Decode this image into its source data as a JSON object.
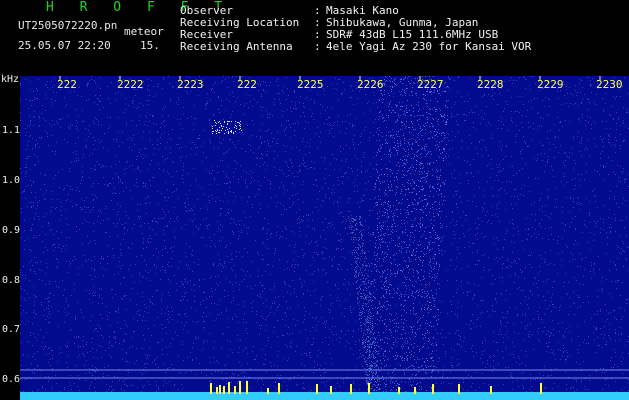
{
  "header": {
    "title": "H R O F F T",
    "file_name": "UT2505072220.pn",
    "file_suffix": "meteor",
    "date_time": "25.05.07 22:20",
    "count": "15.",
    "info": [
      {
        "label": "Observer",
        "value": "Masaki Kano"
      },
      {
        "label": "Receiving Location",
        "value": "Shibukawa, Gunma, Japan"
      },
      {
        "label": "Receiver",
        "value": "SDR# 43dB L15 111.6MHz USB"
      },
      {
        "label": "Receiving Antenna",
        "value": "4ele Yagi Az 230 for Kansai VOR"
      }
    ],
    "colon": ":"
  },
  "spectrogram": {
    "unit": "kHz",
    "x_tick_labels": [
      "222",
      "2222",
      "2223",
      "222",
      "2225",
      "2226",
      "2227",
      "2228",
      "2229",
      "2230"
    ],
    "y_tick_labels": [
      "1.1",
      "1.0",
      "0.9",
      "0.8",
      "0.7",
      "0.6"
    ],
    "background_color": "#040a8e",
    "noise_color": "#3c78ff",
    "signal_color": "#9fdcff",
    "spike_color": "#ffff33",
    "baseline_color": "#33ccff",
    "tick_color": "#ffff66"
  }
}
